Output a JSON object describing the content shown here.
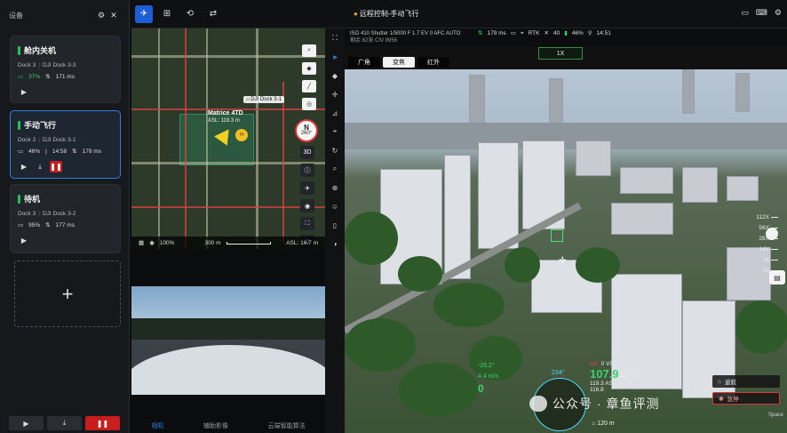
{
  "sidebar": {
    "title": "设备",
    "cards": [
      {
        "status": "舱内关机",
        "dock": "Dock 3",
        "model": "DJI Dock 3-3",
        "battery": "37%",
        "latency": "171 ms"
      },
      {
        "status": "手动飞行",
        "dock": "Dock 3",
        "model": "DJI Dock 3-1",
        "battery": "46%",
        "time": "14:58",
        "latency": "179 ms"
      },
      {
        "status": "待机",
        "dock": "Dock 3",
        "model": "DJI Dock 3-2",
        "battery": "95%",
        "latency": "177 ms"
      }
    ],
    "add_symbol": "+"
  },
  "topbar": {
    "title": "远程控制-手动飞行"
  },
  "map": {
    "dock_label": "DJI Dock 3-1",
    "drone_name": "Matrice 4TD",
    "drone_asl": "ASL: 119.3 m",
    "home_marker": "H",
    "compass_n": "N",
    "compass_deg": "260°",
    "btn_3d": "3D",
    "zoom": "100%",
    "scale": "300 m",
    "asl": "ASL: 16.7 m"
  },
  "subtabs": [
    "相机",
    "辅助影像",
    "云端智能算法"
  ],
  "camera": {
    "info_row1": "ISO 410  Shutter 1/5000  F 1.7  EV 0   AFC  AUTO",
    "info_row2": "剩余  82张  CIV 9956",
    "alt_status": "179 ms",
    "rtk_label": "RTK",
    "rtk_value": "40",
    "batt": "46%",
    "time": "14:51",
    "tabs": [
      "广角",
      "变焦",
      "红外"
    ],
    "zoom": "1X",
    "zoom_levels": [
      "112X",
      "56X",
      "28X",
      "14X",
      "7X",
      "1X"
    ],
    "heading": "234°",
    "pitch": "-26.2°",
    "speed": "4.4 m/s",
    "speed_val": "0",
    "alt_na": "NA",
    "vs": "0 VS",
    "alt": "107.9",
    "alt_unit": "ALT m",
    "asl": "119.3 ASL",
    "asl2": "116.8",
    "dist": "120 m",
    "btn_return": "返航",
    "btn_emergency": "急停",
    "space_label": "Space"
  },
  "watermark": "公众号 · 章鱼评测"
}
